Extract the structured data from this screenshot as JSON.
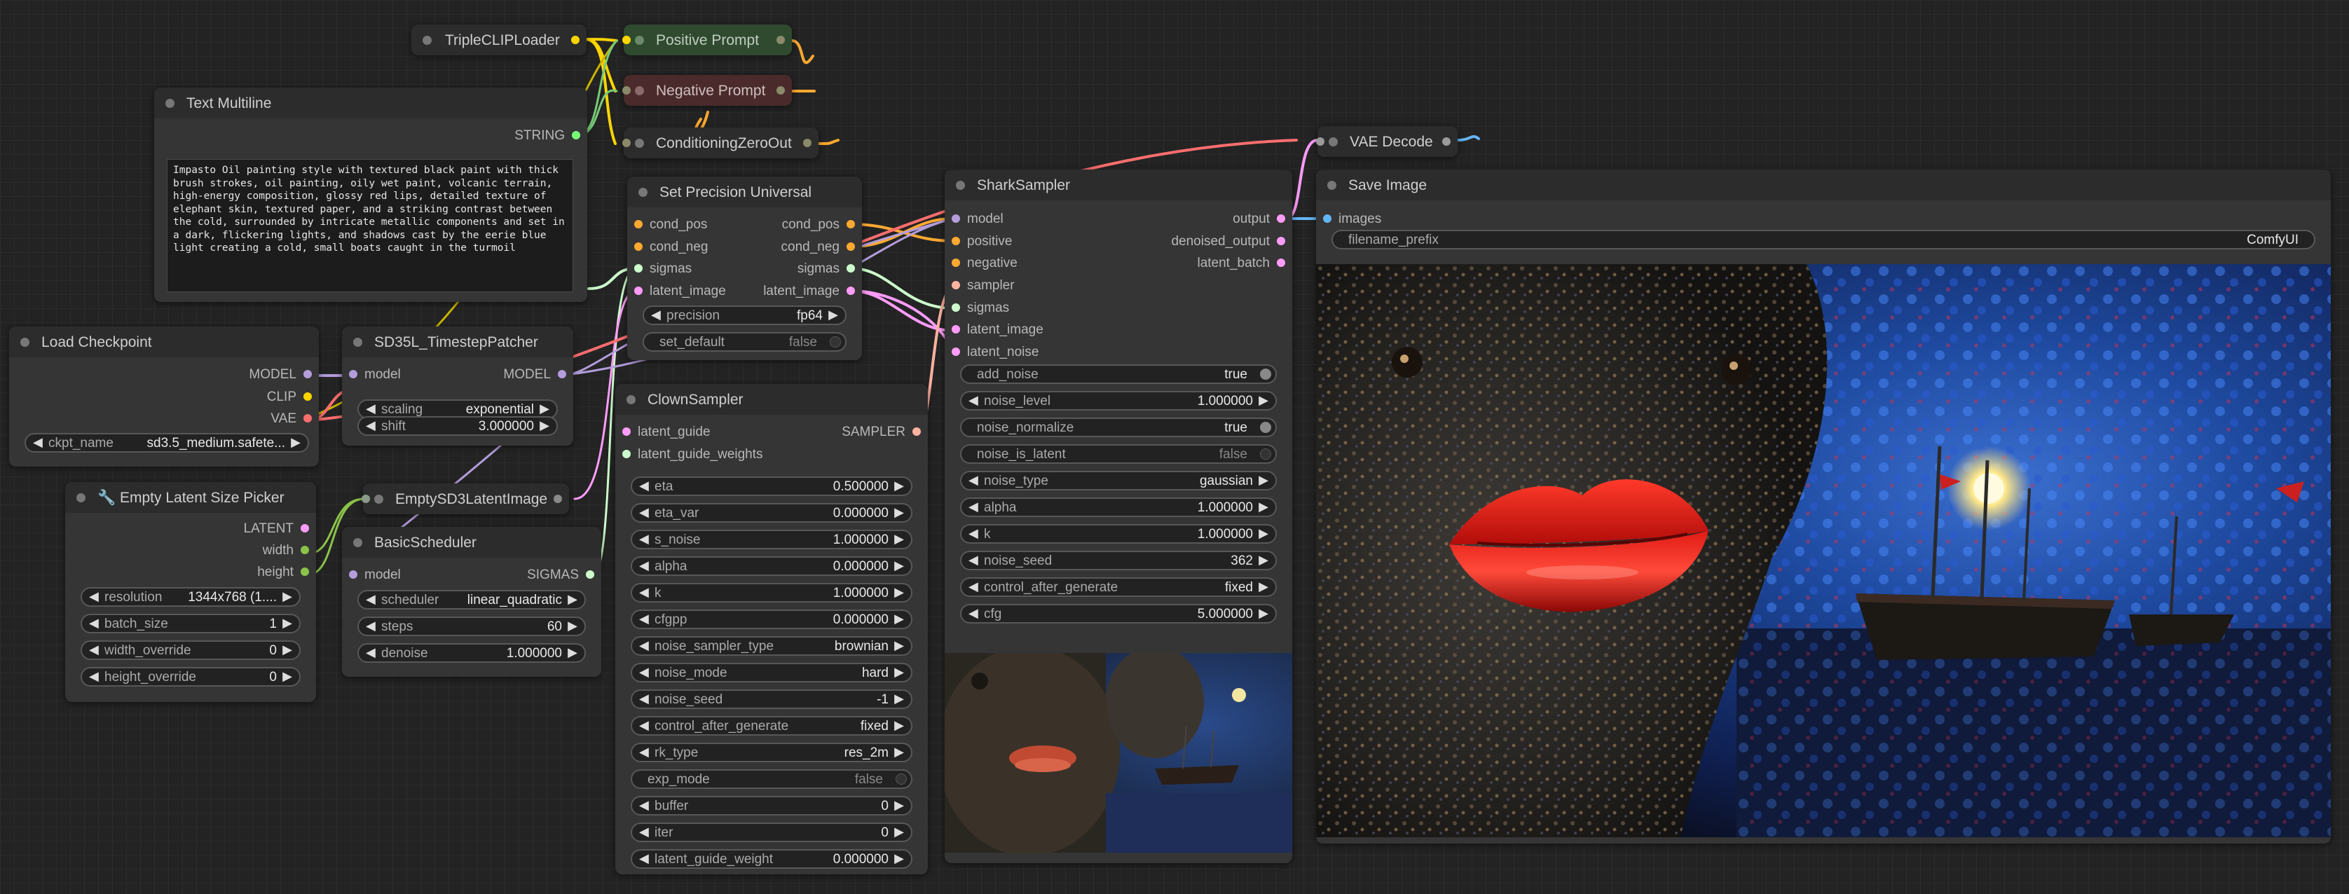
{
  "nodes": {
    "triple_clip": {
      "title": "TripleCLIPLoader"
    },
    "positive_prompt": {
      "title": "Positive Prompt"
    },
    "negative_prompt": {
      "title": "Negative Prompt"
    },
    "conditioning_zero": {
      "title": "ConditioningZeroOut"
    },
    "vae_decode": {
      "title": "VAE Decode"
    },
    "text_multiline": {
      "title": "Text Multiline",
      "output": "STRING",
      "text": "Impasto Oil painting style with textured black paint with thick brush strokes, oil painting, oily wet paint, volcanic terrain, high-energy composition, glossy red lips, detailed texture of elephant skin, textured paper, and a striking contrast between the cold, surrounded by intricate metallic components and set in a dark, flickering lights, and shadows cast by the eerie blue light creating a cold, small boats caught in the turmoil"
    },
    "load_checkpoint": {
      "title": "Load Checkpoint",
      "outputs": [
        "MODEL",
        "CLIP",
        "VAE"
      ],
      "ckpt_label": "ckpt_name",
      "ckpt_value": "sd3.5_medium.safete..."
    },
    "timestep_patcher": {
      "title": "SD35L_TimestepPatcher",
      "input": "model",
      "output": "MODEL",
      "scaling_label": "scaling",
      "scaling_value": "exponential",
      "shift_label": "shift",
      "shift_value": "3.000000"
    },
    "latent_picker": {
      "title": "🔧 Empty Latent Size Picker",
      "outputs": [
        "LATENT",
        "width",
        "height"
      ],
      "widgets": [
        {
          "label": "resolution",
          "value": "1344x768 (1...."
        },
        {
          "label": "batch_size",
          "value": "1"
        },
        {
          "label": "width_override",
          "value": "0"
        },
        {
          "label": "height_override",
          "value": "0"
        }
      ]
    },
    "empty_sd3": {
      "title": "EmptySD3LatentImage"
    },
    "basic_scheduler": {
      "title": "BasicScheduler",
      "input": "model",
      "output": "SIGMAS",
      "widgets": [
        {
          "label": "scheduler",
          "value": "linear_quadratic"
        },
        {
          "label": "steps",
          "value": "60"
        },
        {
          "label": "denoise",
          "value": "1.000000"
        }
      ]
    },
    "set_precision": {
      "title": "Set Precision Universal",
      "inputs": [
        "cond_pos",
        "cond_neg",
        "sigmas",
        "latent_image"
      ],
      "outputs": [
        "cond_pos",
        "cond_neg",
        "sigmas",
        "latent_image"
      ],
      "precision_label": "precision",
      "precision_value": "fp64",
      "set_default_label": "set_default",
      "set_default_value": "false"
    },
    "clown_sampler": {
      "title": "ClownSampler",
      "inputs": [
        "latent_guide",
        "latent_guide_weights"
      ],
      "output": "SAMPLER",
      "widgets": [
        {
          "label": "eta",
          "value": "0.500000",
          "kind": "num"
        },
        {
          "label": "eta_var",
          "value": "0.000000",
          "kind": "num"
        },
        {
          "label": "s_noise",
          "value": "1.000000",
          "kind": "num"
        },
        {
          "label": "alpha",
          "value": "0.000000",
          "kind": "num"
        },
        {
          "label": "k",
          "value": "1.000000",
          "kind": "num"
        },
        {
          "label": "cfgpp",
          "value": "0.000000",
          "kind": "num"
        },
        {
          "label": "noise_sampler_type",
          "value": "brownian",
          "kind": "num"
        },
        {
          "label": "noise_mode",
          "value": "hard",
          "kind": "num"
        },
        {
          "label": "noise_seed",
          "value": "-1",
          "kind": "num"
        },
        {
          "label": "control_after_generate",
          "value": "fixed",
          "kind": "num"
        },
        {
          "label": "rk_type",
          "value": "res_2m",
          "kind": "num"
        },
        {
          "label": "exp_mode",
          "value": "false",
          "kind": "toggle_off"
        },
        {
          "label": "buffer",
          "value": "0",
          "kind": "num"
        },
        {
          "label": "iter",
          "value": "0",
          "kind": "num"
        },
        {
          "label": "latent_guide_weight",
          "value": "0.000000",
          "kind": "num"
        }
      ]
    },
    "shark_sampler": {
      "title": "SharkSampler",
      "inputs": [
        "model",
        "positive",
        "negative",
        "sampler",
        "sigmas",
        "latent_image",
        "latent_noise"
      ],
      "outputs": [
        "output",
        "denoised_output",
        "latent_batch"
      ],
      "widgets": [
        {
          "label": "add_noise",
          "value": "true",
          "kind": "toggle_on"
        },
        {
          "label": "noise_level",
          "value": "1.000000",
          "kind": "num"
        },
        {
          "label": "noise_normalize",
          "value": "true",
          "kind": "toggle_on"
        },
        {
          "label": "noise_is_latent",
          "value": "false",
          "kind": "toggle_off"
        },
        {
          "label": "noise_type",
          "value": "gaussian",
          "kind": "num"
        },
        {
          "label": "alpha",
          "value": "1.000000",
          "kind": "num"
        },
        {
          "label": "k",
          "value": "1.000000",
          "kind": "num"
        },
        {
          "label": "noise_seed",
          "value": "362",
          "kind": "num"
        },
        {
          "label": "control_after_generate",
          "value": "fixed",
          "kind": "num"
        },
        {
          "label": "cfg",
          "value": "5.000000",
          "kind": "num"
        }
      ]
    },
    "save_image": {
      "title": "Save Image",
      "input": "images",
      "prefix_label": "filename_prefix",
      "prefix_value": "ComfyUI"
    }
  },
  "colors": {
    "canvas": "#232323",
    "node_body": "#353535",
    "node_title": "#2c2c2c",
    "model": "#b39ddb",
    "clip": "#ffd500",
    "vae": "#ff6e6e",
    "conditioning": "#ffa931",
    "latent": "#ff9cf9",
    "sigmas": "#cdffcd",
    "string": "#77ff77",
    "sampler": "#ffb2a0",
    "image": "#64b5f6",
    "positive_title": "#2f4a2f",
    "negative_title": "#4a2a2a"
  }
}
